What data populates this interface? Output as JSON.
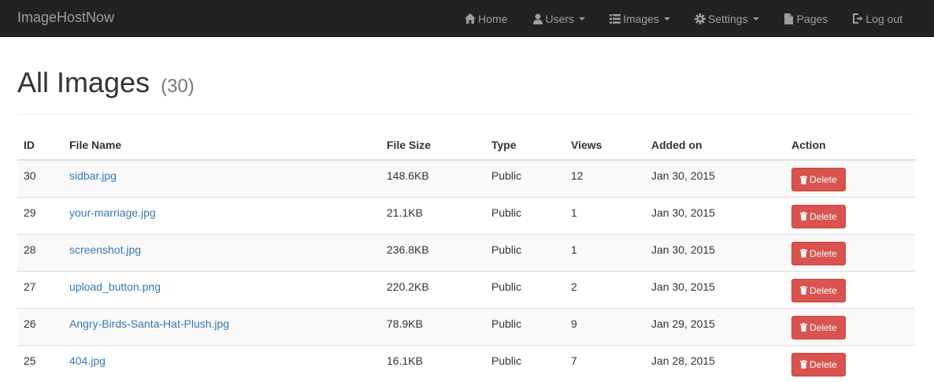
{
  "navbar": {
    "brand": "ImageHostNow",
    "items": [
      {
        "label": "Home",
        "icon": "home-icon",
        "dropdown": false
      },
      {
        "label": "Users",
        "icon": "user-icon",
        "dropdown": true
      },
      {
        "label": "Images",
        "icon": "list-icon",
        "dropdown": true
      },
      {
        "label": "Settings",
        "icon": "gear-icon",
        "dropdown": true
      },
      {
        "label": "Pages",
        "icon": "file-icon",
        "dropdown": false
      },
      {
        "label": "Log out",
        "icon": "logout-icon",
        "dropdown": false
      }
    ]
  },
  "header": {
    "title": "All Images",
    "count": "(30)"
  },
  "table": {
    "columns": [
      "ID",
      "File Name",
      "File Size",
      "Type",
      "Views",
      "Added on",
      "Action"
    ],
    "rows": [
      {
        "id": "30",
        "file": "sidbar.jpg",
        "size": "148.6KB",
        "type": "Public",
        "views": "12",
        "added": "Jan 30, 2015",
        "action": "Delete"
      },
      {
        "id": "29",
        "file": "your-marriage.jpg",
        "size": "21.1KB",
        "type": "Public",
        "views": "1",
        "added": "Jan 30, 2015",
        "action": "Delete"
      },
      {
        "id": "28",
        "file": "screenshot.jpg",
        "size": "236.8KB",
        "type": "Public",
        "views": "1",
        "added": "Jan 30, 2015",
        "action": "Delete"
      },
      {
        "id": "27",
        "file": "upload_button.png",
        "size": "220.2KB",
        "type": "Public",
        "views": "2",
        "added": "Jan 30, 2015",
        "action": "Delete"
      },
      {
        "id": "26",
        "file": "Angry-Birds-Santa-Hat-Plush.jpg",
        "size": "78.9KB",
        "type": "Public",
        "views": "9",
        "added": "Jan 29, 2015",
        "action": "Delete"
      },
      {
        "id": "25",
        "file": "404.jpg",
        "size": "16.1KB",
        "type": "Public",
        "views": "7",
        "added": "Jan 28, 2015",
        "action": "Delete"
      }
    ]
  },
  "colors": {
    "navbar_bg": "#222222",
    "nav_text": "#9d9d9d",
    "link": "#337ab7",
    "danger": "#d9534f"
  }
}
